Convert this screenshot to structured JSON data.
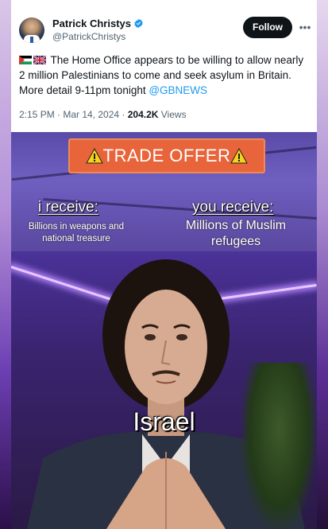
{
  "author": {
    "name": "Patrick Christys",
    "handle": "@PatrickChristys",
    "verified": true
  },
  "follow_label": "Follow",
  "more_icon": "more-dots-icon",
  "tweet": {
    "flags": [
      "palestine-flag-icon",
      "uk-flag-icon"
    ],
    "text": "The Home Office appears to be willing to allow nearly 2 million Palestinians to come and seek asylum in Britain. More detail 9-11pm tonight ",
    "mention": "@GBNEWS",
    "time": "2:15 PM · Mar 14, 2024 · ",
    "views_count": "204.2K",
    "views_label": " Views"
  },
  "meme": {
    "banner": "TRADE OFFER",
    "i_receive_title": "i receive:",
    "i_receive_value": "Billions in weapons and national treasure",
    "you_receive_title": "you receive:",
    "you_receive_value": "Millions of Muslim refugees",
    "person_label": "Israel"
  },
  "colors": {
    "verified": "#1d9bf0",
    "banner": "#e8643a",
    "mention": "#1d9bf0"
  }
}
